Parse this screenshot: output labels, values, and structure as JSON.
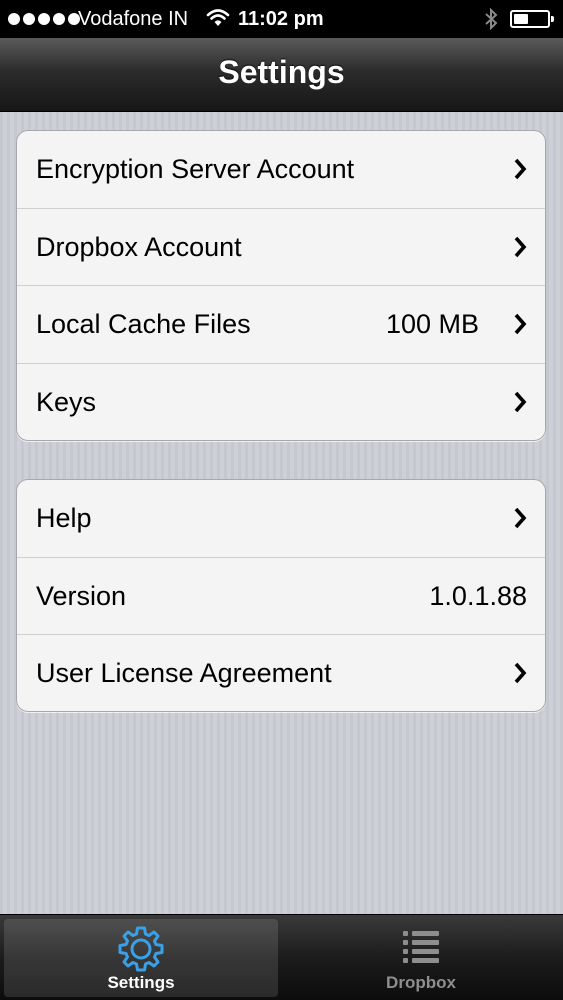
{
  "status_bar": {
    "carrier": "Vodafone IN",
    "time": "11:02 pm",
    "signal_bars": 5
  },
  "nav": {
    "title": "Settings"
  },
  "groups": [
    {
      "items": [
        {
          "label": "Encryption Server Account",
          "value": "",
          "has_chevron": true
        },
        {
          "label": "Dropbox Account",
          "value": "",
          "has_chevron": true
        },
        {
          "label": "Local Cache Files",
          "value": "100 MB",
          "has_chevron": true
        },
        {
          "label": "Keys",
          "value": "",
          "has_chevron": true
        }
      ]
    },
    {
      "items": [
        {
          "label": "Help",
          "value": "",
          "has_chevron": true
        },
        {
          "label": "Version",
          "value": "1.0.1.88",
          "has_chevron": false
        },
        {
          "label": "User License Agreement",
          "value": "",
          "has_chevron": true
        }
      ]
    }
  ],
  "tabs": [
    {
      "label": "Settings",
      "icon": "gear-icon",
      "selected": true
    },
    {
      "label": "Dropbox",
      "icon": "list-icon",
      "selected": false
    }
  ],
  "colors": {
    "tab_icon_active": "#3aa0e8",
    "tab_icon_inactive": "#8e8e8e"
  }
}
